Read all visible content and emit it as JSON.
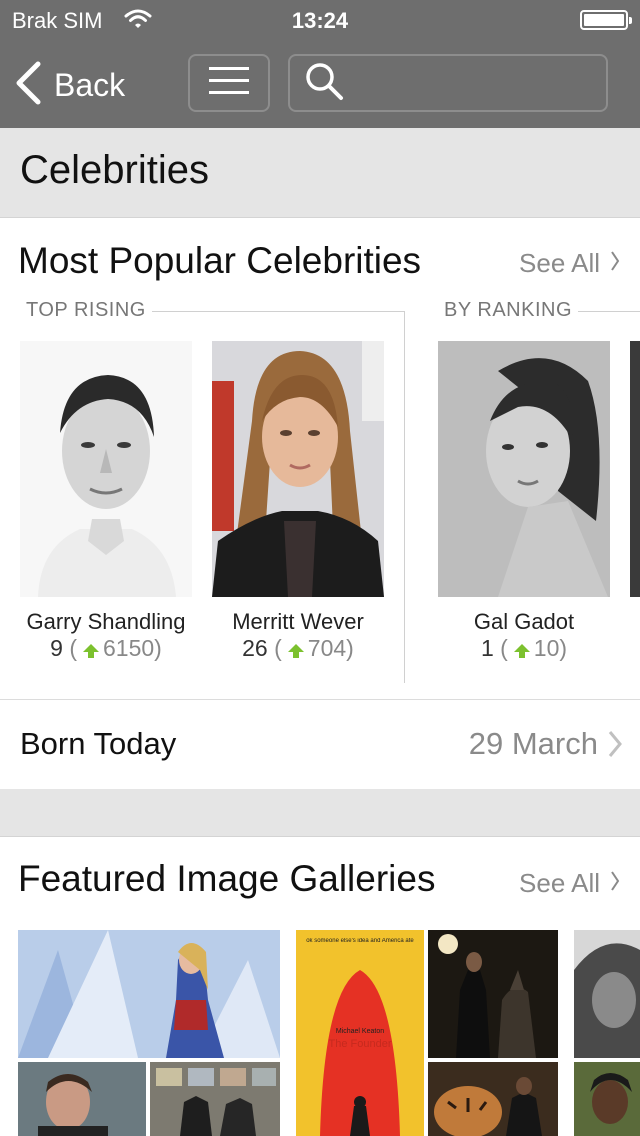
{
  "status_bar": {
    "carrier": "Brak SIM",
    "time": "13:24"
  },
  "nav": {
    "back_label": "Back",
    "search_placeholder": ""
  },
  "page_title": "Celebrities",
  "popular": {
    "title": "Most Popular Celebrities",
    "see_all": "See All",
    "top_rising_label": "TOP RISING",
    "by_ranking_label": "BY RANKING",
    "celebrities": [
      {
        "name": "Garry Shandling",
        "rank": "9",
        "change": "6150"
      },
      {
        "name": "Merritt Wever",
        "rank": "26",
        "change": "704"
      },
      {
        "name": "Gal Gadot",
        "rank": "1",
        "change": "10"
      }
    ]
  },
  "born_today": {
    "label": "Born Today",
    "date": "29 March"
  },
  "galleries": {
    "title": "Featured Image Galleries",
    "see_all": "See All",
    "poster_tagline": "ok someone else's idea and America ate",
    "poster_credit": "Michael Keaton",
    "poster_title": "The Founder"
  },
  "colors": {
    "top_bar": "#6e6e6e",
    "band": "#e5e5e5",
    "rising_arrow": "#7cc12e",
    "muted_text": "#8a8a8a"
  },
  "icons": [
    "wifi-icon",
    "battery-icon",
    "back-chevron-icon",
    "hamburger-menu-icon",
    "search-icon",
    "chevron-right-icon",
    "up-arrow-icon"
  ]
}
